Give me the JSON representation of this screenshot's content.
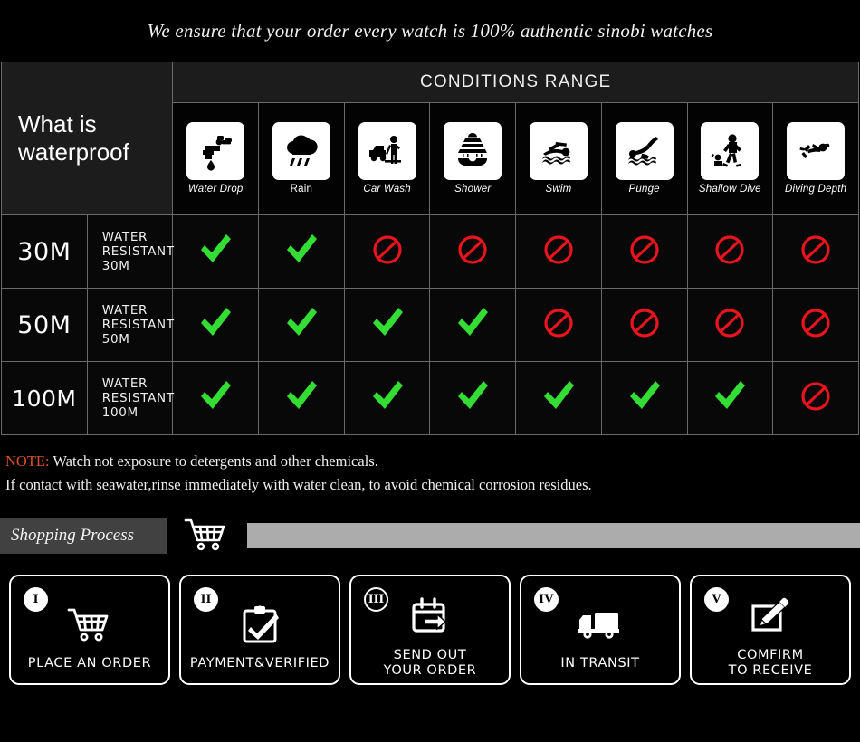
{
  "headline": "We ensure that your order every watch is 100% authentic sinobi watches",
  "table": {
    "title_cell": "What is waterproof",
    "conditions_header": "CONDITIONS RANGE",
    "columns": [
      {
        "label": "Water Drop",
        "icon": "faucet-drip-icon",
        "italic": true
      },
      {
        "label": "Rain",
        "icon": "rain-cloud-icon",
        "italic": false
      },
      {
        "label": "Car Wash",
        "icon": "car-wash-icon",
        "italic": true
      },
      {
        "label": "Shower",
        "icon": "shower-icon",
        "italic": true
      },
      {
        "label": "Swim",
        "icon": "swimmer-icon",
        "italic": true
      },
      {
        "label": "Punge",
        "icon": "plunge-dive-icon",
        "italic": true
      },
      {
        "label": "Shallow Dive",
        "icon": "shallow-dive-icon",
        "italic": true
      },
      {
        "label": "Diving Depth",
        "icon": "scuba-diver-icon",
        "italic": true
      }
    ],
    "rows": [
      {
        "depth": "30M",
        "description": "WATER RESISTANT  30M",
        "marks": [
          "check",
          "check",
          "ban",
          "ban",
          "ban",
          "ban",
          "ban",
          "ban"
        ]
      },
      {
        "depth": "50M",
        "description": "WATER RESISTANT 50M",
        "marks": [
          "check",
          "check",
          "check",
          "check",
          "ban",
          "ban",
          "ban",
          "ban"
        ]
      },
      {
        "depth": "100M",
        "description": "WATER RESISTANT  100M",
        "marks": [
          "check",
          "check",
          "check",
          "check",
          "check",
          "check",
          "check",
          "ban"
        ]
      }
    ]
  },
  "note": {
    "keyword": "NOTE:",
    "line1": " Watch not exposure to detergents and other chemicals.",
    "line2": "If contact with seawater,rinse immediately with water clean, to avoid chemical corrosion residues."
  },
  "shopping_process": {
    "tag": "Shopping Process",
    "cart_icon": "shopping-cart-icon"
  },
  "steps": [
    {
      "numeral": "I",
      "label": "PLACE AN ORDER",
      "icon": "shopping-cart-icon",
      "badge_style": "filled"
    },
    {
      "numeral": "II",
      "label": "PAYMENT&VERIFIED",
      "icon": "clipboard-check-icon",
      "badge_style": "filled"
    },
    {
      "numeral": "III",
      "label": "SEND OUT\nYOUR ORDER",
      "icon": "calendar-arrow-icon",
      "badge_style": "outline"
    },
    {
      "numeral": "IV",
      "label": "IN TRANSIT",
      "icon": "delivery-truck-icon",
      "badge_style": "filled"
    },
    {
      "numeral": "V",
      "label": "COMFIRM\nTO RECEIVE",
      "icon": "edit-box-pencil-icon",
      "badge_style": "filled"
    }
  ],
  "colors": {
    "check_green": "#33dd33",
    "ban_red": "#e8141e",
    "note_keyword": "#d9512c",
    "tag_bg": "#414141",
    "bar_gray": "#acacac",
    "header_cell_bg": "#1c1c1c",
    "grid_line": "#6a6a6a"
  }
}
